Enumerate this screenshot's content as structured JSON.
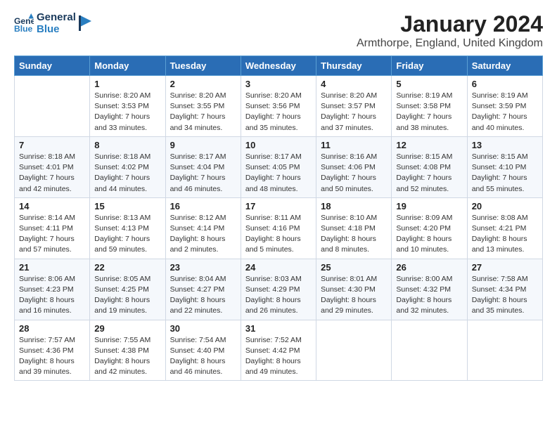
{
  "logo": {
    "line1": "General",
    "line2": "Blue"
  },
  "title": "January 2024",
  "subtitle": "Armthorpe, England, United Kingdom",
  "header_days": [
    "Sunday",
    "Monday",
    "Tuesday",
    "Wednesday",
    "Thursday",
    "Friday",
    "Saturday"
  ],
  "weeks": [
    [
      {
        "day": "",
        "info": ""
      },
      {
        "day": "1",
        "info": "Sunrise: 8:20 AM\nSunset: 3:53 PM\nDaylight: 7 hours\nand 33 minutes."
      },
      {
        "day": "2",
        "info": "Sunrise: 8:20 AM\nSunset: 3:55 PM\nDaylight: 7 hours\nand 34 minutes."
      },
      {
        "day": "3",
        "info": "Sunrise: 8:20 AM\nSunset: 3:56 PM\nDaylight: 7 hours\nand 35 minutes."
      },
      {
        "day": "4",
        "info": "Sunrise: 8:20 AM\nSunset: 3:57 PM\nDaylight: 7 hours\nand 37 minutes."
      },
      {
        "day": "5",
        "info": "Sunrise: 8:19 AM\nSunset: 3:58 PM\nDaylight: 7 hours\nand 38 minutes."
      },
      {
        "day": "6",
        "info": "Sunrise: 8:19 AM\nSunset: 3:59 PM\nDaylight: 7 hours\nand 40 minutes."
      }
    ],
    [
      {
        "day": "7",
        "info": "Sunrise: 8:18 AM\nSunset: 4:01 PM\nDaylight: 7 hours\nand 42 minutes."
      },
      {
        "day": "8",
        "info": "Sunrise: 8:18 AM\nSunset: 4:02 PM\nDaylight: 7 hours\nand 44 minutes."
      },
      {
        "day": "9",
        "info": "Sunrise: 8:17 AM\nSunset: 4:04 PM\nDaylight: 7 hours\nand 46 minutes."
      },
      {
        "day": "10",
        "info": "Sunrise: 8:17 AM\nSunset: 4:05 PM\nDaylight: 7 hours\nand 48 minutes."
      },
      {
        "day": "11",
        "info": "Sunrise: 8:16 AM\nSunset: 4:06 PM\nDaylight: 7 hours\nand 50 minutes."
      },
      {
        "day": "12",
        "info": "Sunrise: 8:15 AM\nSunset: 4:08 PM\nDaylight: 7 hours\nand 52 minutes."
      },
      {
        "day": "13",
        "info": "Sunrise: 8:15 AM\nSunset: 4:10 PM\nDaylight: 7 hours\nand 55 minutes."
      }
    ],
    [
      {
        "day": "14",
        "info": "Sunrise: 8:14 AM\nSunset: 4:11 PM\nDaylight: 7 hours\nand 57 minutes."
      },
      {
        "day": "15",
        "info": "Sunrise: 8:13 AM\nSunset: 4:13 PM\nDaylight: 7 hours\nand 59 minutes."
      },
      {
        "day": "16",
        "info": "Sunrise: 8:12 AM\nSunset: 4:14 PM\nDaylight: 8 hours\nand 2 minutes."
      },
      {
        "day": "17",
        "info": "Sunrise: 8:11 AM\nSunset: 4:16 PM\nDaylight: 8 hours\nand 5 minutes."
      },
      {
        "day": "18",
        "info": "Sunrise: 8:10 AM\nSunset: 4:18 PM\nDaylight: 8 hours\nand 8 minutes."
      },
      {
        "day": "19",
        "info": "Sunrise: 8:09 AM\nSunset: 4:20 PM\nDaylight: 8 hours\nand 10 minutes."
      },
      {
        "day": "20",
        "info": "Sunrise: 8:08 AM\nSunset: 4:21 PM\nDaylight: 8 hours\nand 13 minutes."
      }
    ],
    [
      {
        "day": "21",
        "info": "Sunrise: 8:06 AM\nSunset: 4:23 PM\nDaylight: 8 hours\nand 16 minutes."
      },
      {
        "day": "22",
        "info": "Sunrise: 8:05 AM\nSunset: 4:25 PM\nDaylight: 8 hours\nand 19 minutes."
      },
      {
        "day": "23",
        "info": "Sunrise: 8:04 AM\nSunset: 4:27 PM\nDaylight: 8 hours\nand 22 minutes."
      },
      {
        "day": "24",
        "info": "Sunrise: 8:03 AM\nSunset: 4:29 PM\nDaylight: 8 hours\nand 26 minutes."
      },
      {
        "day": "25",
        "info": "Sunrise: 8:01 AM\nSunset: 4:30 PM\nDaylight: 8 hours\nand 29 minutes."
      },
      {
        "day": "26",
        "info": "Sunrise: 8:00 AM\nSunset: 4:32 PM\nDaylight: 8 hours\nand 32 minutes."
      },
      {
        "day": "27",
        "info": "Sunrise: 7:58 AM\nSunset: 4:34 PM\nDaylight: 8 hours\nand 35 minutes."
      }
    ],
    [
      {
        "day": "28",
        "info": "Sunrise: 7:57 AM\nSunset: 4:36 PM\nDaylight: 8 hours\nand 39 minutes."
      },
      {
        "day": "29",
        "info": "Sunrise: 7:55 AM\nSunset: 4:38 PM\nDaylight: 8 hours\nand 42 minutes."
      },
      {
        "day": "30",
        "info": "Sunrise: 7:54 AM\nSunset: 4:40 PM\nDaylight: 8 hours\nand 46 minutes."
      },
      {
        "day": "31",
        "info": "Sunrise: 7:52 AM\nSunset: 4:42 PM\nDaylight: 8 hours\nand 49 minutes."
      },
      {
        "day": "",
        "info": ""
      },
      {
        "day": "",
        "info": ""
      },
      {
        "day": "",
        "info": ""
      }
    ]
  ]
}
